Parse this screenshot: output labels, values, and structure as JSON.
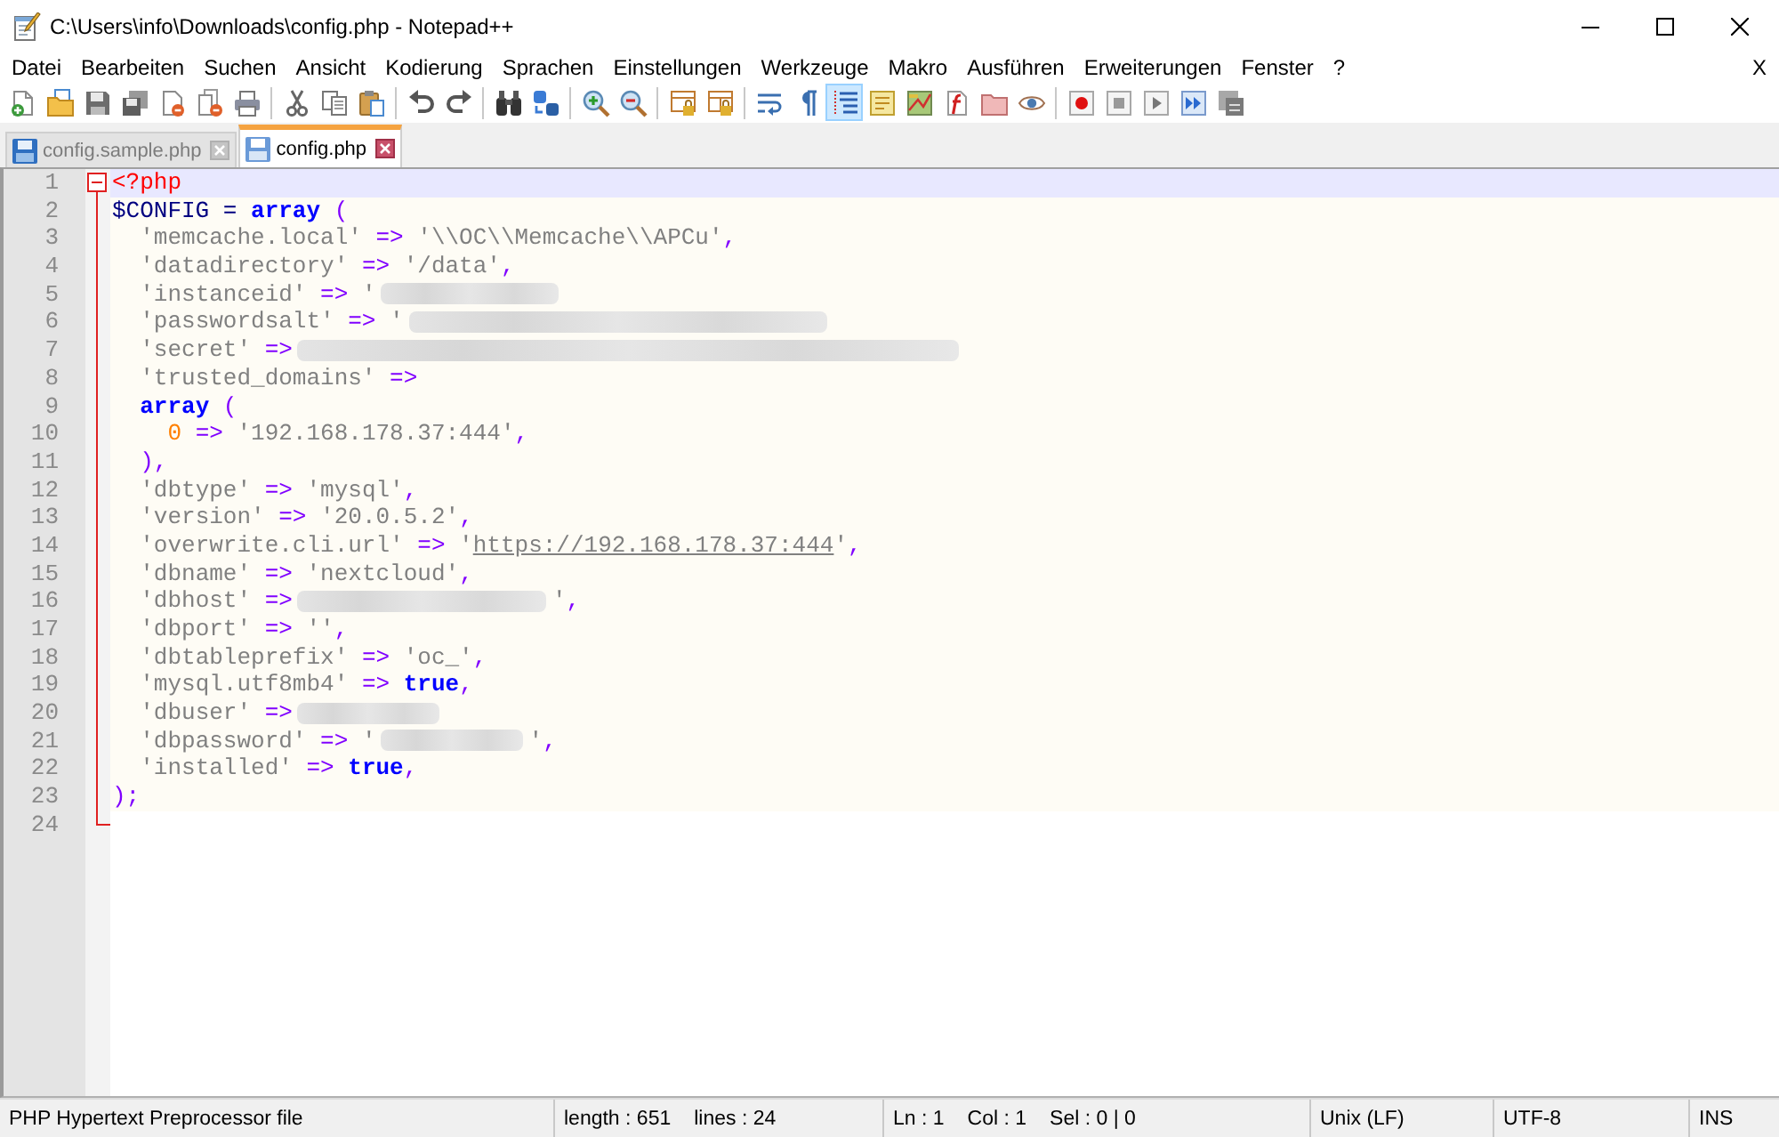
{
  "window": {
    "title": "C:\\Users\\info\\Downloads\\config.php - Notepad++"
  },
  "menu": {
    "items": [
      "Datei",
      "Bearbeiten",
      "Suchen",
      "Ansicht",
      "Kodierung",
      "Sprachen",
      "Einstellungen",
      "Werkzeuge",
      "Makro",
      "Ausführen",
      "Erweiterungen",
      "Fenster",
      "?"
    ],
    "close_label": "X"
  },
  "toolbar": {
    "groups": [
      {
        "buttons": [
          {
            "kind": "new",
            "pressed": false
          },
          {
            "kind": "open",
            "pressed": false
          },
          {
            "kind": "save",
            "pressed": false
          },
          {
            "kind": "save_all",
            "pressed": false
          },
          {
            "kind": "close",
            "pressed": false
          },
          {
            "kind": "close_all",
            "pressed": false
          },
          {
            "kind": "print",
            "pressed": false
          }
        ]
      },
      {
        "buttons": [
          {
            "kind": "cut",
            "pressed": false
          },
          {
            "kind": "copy",
            "pressed": false
          },
          {
            "kind": "paste",
            "pressed": false
          }
        ]
      },
      {
        "buttons": [
          {
            "kind": "undo",
            "pressed": false
          },
          {
            "kind": "redo",
            "pressed": false
          }
        ]
      },
      {
        "buttons": [
          {
            "kind": "find",
            "pressed": false
          },
          {
            "kind": "replace",
            "pressed": false
          }
        ]
      },
      {
        "buttons": [
          {
            "kind": "zoom_in",
            "pressed": false
          },
          {
            "kind": "zoom_out",
            "pressed": false
          }
        ]
      },
      {
        "buttons": [
          {
            "kind": "sync_vertical",
            "pressed": false
          },
          {
            "kind": "sync_horizontal",
            "pressed": false
          }
        ]
      },
      {
        "buttons": [
          {
            "kind": "word_wrap",
            "pressed": false
          },
          {
            "kind": "show_all_chars",
            "pressed": false
          },
          {
            "kind": "indent_guide",
            "pressed": true
          },
          {
            "kind": "udl",
            "pressed": false
          },
          {
            "kind": "doc_map",
            "pressed": false
          },
          {
            "kind": "function_list",
            "pressed": false
          },
          {
            "kind": "folder_workspace",
            "pressed": false
          },
          {
            "kind": "monitoring",
            "pressed": false
          }
        ]
      },
      {
        "buttons": [
          {
            "kind": "record",
            "pressed": false
          },
          {
            "kind": "stop",
            "pressed": false
          },
          {
            "kind": "play",
            "pressed": false
          },
          {
            "kind": "play_multiple",
            "pressed": false
          },
          {
            "kind": "save_macro",
            "pressed": false
          }
        ]
      }
    ]
  },
  "tabs": [
    {
      "label": "config.sample.php",
      "selected": false
    },
    {
      "label": "config.php",
      "selected": true
    }
  ],
  "editor": {
    "fold": {
      "expanded": true
    },
    "lines": [
      {
        "number": "1",
        "current": true,
        "tokens": [
          {
            "kind": "tag",
            "text": "<?php"
          }
        ]
      },
      {
        "number": "2",
        "current": false,
        "tokens": [
          {
            "kind": "variable",
            "text": "$CONFIG"
          },
          {
            "kind": "plain",
            "text": " ="
          },
          {
            "kind": "keyword",
            "text": " array"
          },
          {
            "kind": "operator",
            "text": " ("
          }
        ]
      },
      {
        "number": "3",
        "current": false,
        "tokens": [
          {
            "kind": "string",
            "text": "  'memcache.local'"
          },
          {
            "kind": "operator",
            "text": " =>"
          },
          {
            "kind": "string",
            "text": " '\\\\OC\\\\Memcache\\\\APCu'"
          },
          {
            "kind": "operator",
            "text": ","
          }
        ]
      },
      {
        "number": "4",
        "current": false,
        "tokens": [
          {
            "kind": "string",
            "text": "  'datadirectory'"
          },
          {
            "kind": "operator",
            "text": " =>"
          },
          {
            "kind": "string",
            "text": " '/data'"
          },
          {
            "kind": "operator",
            "text": ","
          }
        ]
      },
      {
        "number": "5",
        "current": false,
        "tokens": [
          {
            "kind": "string",
            "text": "  'instanceid'"
          },
          {
            "kind": "operator",
            "text": " =>"
          },
          {
            "kind": "string",
            "text": " '"
          },
          {
            "kind": "redacted_medium"
          }
        ]
      },
      {
        "number": "6",
        "current": false,
        "tokens": [
          {
            "kind": "string",
            "text": "  'passwordsalt'"
          },
          {
            "kind": "operator",
            "text": " =>"
          },
          {
            "kind": "string",
            "text": " '"
          },
          {
            "kind": "redacted_long"
          }
        ]
      },
      {
        "number": "7",
        "current": false,
        "tokens": [
          {
            "kind": "string",
            "text": "  'secret'"
          },
          {
            "kind": "operator",
            "text": " =>"
          },
          {
            "kind": "redacted_very_long"
          }
        ]
      },
      {
        "number": "8",
        "current": false,
        "tokens": [
          {
            "kind": "string",
            "text": "  'trusted_domains'"
          },
          {
            "kind": "operator",
            "text": " =>"
          }
        ]
      },
      {
        "number": "9",
        "current": false,
        "tokens": [
          {
            "kind": "keyword",
            "text": "  array"
          },
          {
            "kind": "operator",
            "text": " ("
          }
        ]
      },
      {
        "number": "10",
        "current": false,
        "tokens": [
          {
            "kind": "number",
            "text": "    0"
          },
          {
            "kind": "operator",
            "text": " =>"
          },
          {
            "kind": "string",
            "text": " '192.168.178.37:444'"
          },
          {
            "kind": "operator",
            "text": ","
          }
        ]
      },
      {
        "number": "11",
        "current": false,
        "tokens": [
          {
            "kind": "operator",
            "text": "  ),"
          }
        ]
      },
      {
        "number": "12",
        "current": false,
        "tokens": [
          {
            "kind": "string",
            "text": "  'dbtype'"
          },
          {
            "kind": "operator",
            "text": " =>"
          },
          {
            "kind": "string",
            "text": " 'mysql'"
          },
          {
            "kind": "operator",
            "text": ","
          }
        ]
      },
      {
        "number": "13",
        "current": false,
        "tokens": [
          {
            "kind": "string",
            "text": "  'version'"
          },
          {
            "kind": "operator",
            "text": " =>"
          },
          {
            "kind": "string",
            "text": " '20.0.5.2'"
          },
          {
            "kind": "operator",
            "text": ","
          }
        ]
      },
      {
        "number": "14",
        "current": false,
        "tokens": [
          {
            "kind": "string",
            "text": "  'overwrite.cli.url'"
          },
          {
            "kind": "operator",
            "text": " =>"
          },
          {
            "kind": "string",
            "text": " '"
          },
          {
            "kind": "link",
            "text": "https://192.168.178.37:444"
          },
          {
            "kind": "string",
            "text": "'"
          },
          {
            "kind": "operator",
            "text": ","
          }
        ]
      },
      {
        "number": "15",
        "current": false,
        "tokens": [
          {
            "kind": "string",
            "text": "  'dbname'"
          },
          {
            "kind": "operator",
            "text": " =>"
          },
          {
            "kind": "string",
            "text": " 'nextcloud'"
          },
          {
            "kind": "operator",
            "text": ","
          }
        ]
      },
      {
        "number": "16",
        "current": false,
        "tokens": [
          {
            "kind": "string",
            "text": "  'dbhost'"
          },
          {
            "kind": "operator",
            "text": " =>"
          },
          {
            "kind": "redacted_wide"
          },
          {
            "kind": "string",
            "text": "'"
          },
          {
            "kind": "operator",
            "text": ","
          }
        ]
      },
      {
        "number": "17",
        "current": false,
        "tokens": [
          {
            "kind": "string",
            "text": "  'dbport'"
          },
          {
            "kind": "operator",
            "text": " =>"
          },
          {
            "kind": "string",
            "text": " ''"
          },
          {
            "kind": "operator",
            "text": ","
          }
        ]
      },
      {
        "number": "18",
        "current": false,
        "tokens": [
          {
            "kind": "string",
            "text": "  'dbtableprefix'"
          },
          {
            "kind": "operator",
            "text": " =>"
          },
          {
            "kind": "string",
            "text": " 'oc_'"
          },
          {
            "kind": "operator",
            "text": ","
          }
        ]
      },
      {
        "number": "19",
        "current": false,
        "tokens": [
          {
            "kind": "string",
            "text": "  'mysql.utf8mb4'"
          },
          {
            "kind": "operator",
            "text": " =>"
          },
          {
            "kind": "keyword",
            "text": " true"
          },
          {
            "kind": "operator",
            "text": ","
          }
        ]
      },
      {
        "number": "20",
        "current": false,
        "tokens": [
          {
            "kind": "string",
            "text": "  'dbuser'"
          },
          {
            "kind": "operator",
            "text": " =>"
          },
          {
            "kind": "redacted_short"
          }
        ]
      },
      {
        "number": "21",
        "current": false,
        "tokens": [
          {
            "kind": "string",
            "text": "  'dbpassword'"
          },
          {
            "kind": "operator",
            "text": " =>"
          },
          {
            "kind": "string",
            "text": " '"
          },
          {
            "kind": "redacted_short"
          },
          {
            "kind": "string",
            "text": "'"
          },
          {
            "kind": "operator",
            "text": ","
          }
        ]
      },
      {
        "number": "22",
        "current": false,
        "tokens": [
          {
            "kind": "string",
            "text": "  'installed'"
          },
          {
            "kind": "operator",
            "text": " =>"
          },
          {
            "kind": "keyword",
            "text": " true"
          },
          {
            "kind": "operator",
            "text": ","
          }
        ]
      },
      {
        "number": "23",
        "current": false,
        "tokens": [
          {
            "kind": "operator",
            "text": ");"
          }
        ]
      },
      {
        "number": "24",
        "current": false
      }
    ]
  },
  "status_bar": {
    "panels": [
      {
        "texts": [
          "PHP Hypertext Preprocessor file"
        ]
      },
      {
        "texts": [
          "length : 651",
          "lines : 24"
        ]
      },
      {
        "texts": [
          "Ln : 1",
          "Col : 1",
          "Sel : 0 | 0"
        ]
      },
      {
        "texts": [
          "Unix (LF)"
        ]
      },
      {
        "texts": [
          "UTF-8"
        ]
      },
      {
        "texts": [
          "INS"
        ]
      }
    ]
  }
}
